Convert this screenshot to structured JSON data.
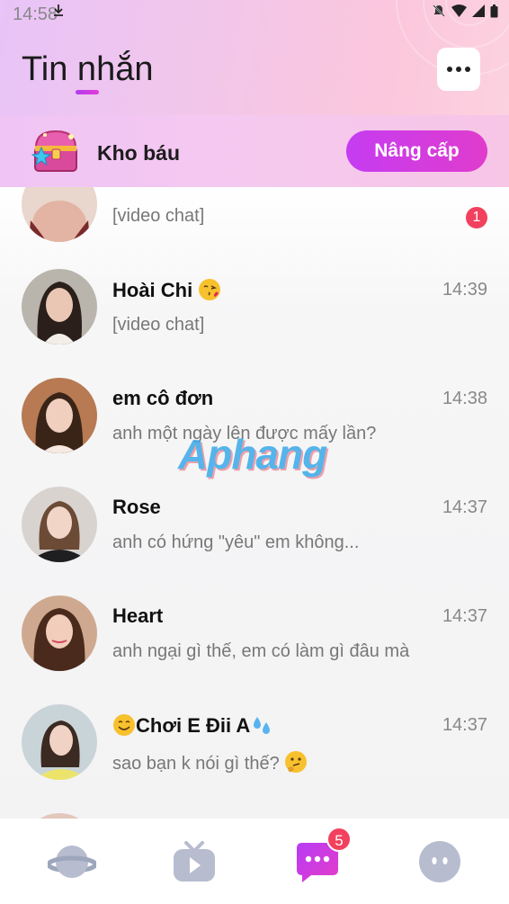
{
  "status_bar": {
    "time": "14:58"
  },
  "header": {
    "title": "Tin nhắn"
  },
  "treasure": {
    "label": "Kho báu",
    "upgrade_label": "Nâng cấp"
  },
  "conversations": [
    {
      "name": "",
      "message": "[video chat]",
      "time": "",
      "unread": "1"
    },
    {
      "name": "Hoài Chi",
      "message": "[video chat]",
      "time": "14:39"
    },
    {
      "name": "em cô đơn",
      "message": "anh một ngày lên được mấy lần?",
      "time": "14:38"
    },
    {
      "name": "Rose",
      "message": "anh có hứng \"yêu\" em không...",
      "time": "14:37"
    },
    {
      "name": "Heart",
      "message": "anh ngại gì thế, em có làm gì đâu mà",
      "time": "14:37"
    },
    {
      "name": "Chơi E Đii A",
      "message": "sao bạn k nói gì thế?",
      "time": "14:37"
    }
  ],
  "watermark": "Aphang",
  "nav": {
    "messages_badge": "5"
  }
}
